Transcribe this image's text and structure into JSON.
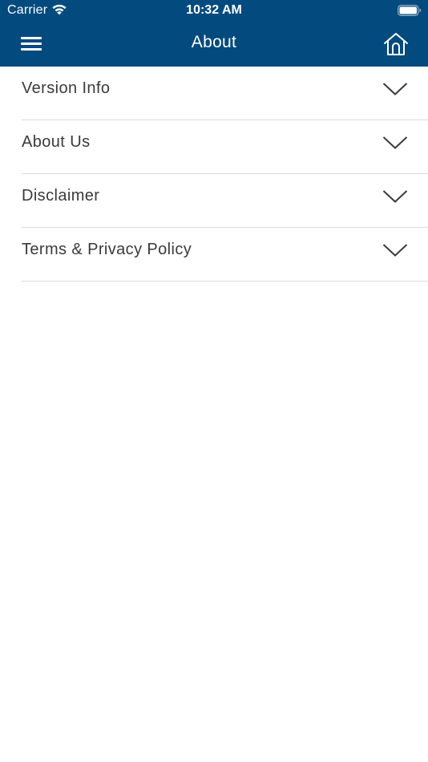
{
  "status_bar": {
    "carrier": "Carrier",
    "time": "10:32 AM",
    "wifi_icon": "wifi-icon",
    "battery_icon": "battery-icon"
  },
  "nav": {
    "title": "About",
    "menu_icon": "hamburger-menu-icon",
    "home_icon": "home-icon"
  },
  "colors": {
    "header_bg": "#034a7e",
    "header_text": "#ffffff",
    "row_text": "#3a3a3a",
    "divider": "#dcdcdc",
    "chevron": "#3a3a3a"
  },
  "sections": [
    {
      "label": "Version Info",
      "icon": "chevron-down-icon"
    },
    {
      "label": "About Us",
      "icon": "chevron-down-icon"
    },
    {
      "label": "Disclaimer",
      "icon": "chevron-down-icon"
    },
    {
      "label": "Terms & Privacy Policy",
      "icon": "chevron-down-icon"
    }
  ]
}
